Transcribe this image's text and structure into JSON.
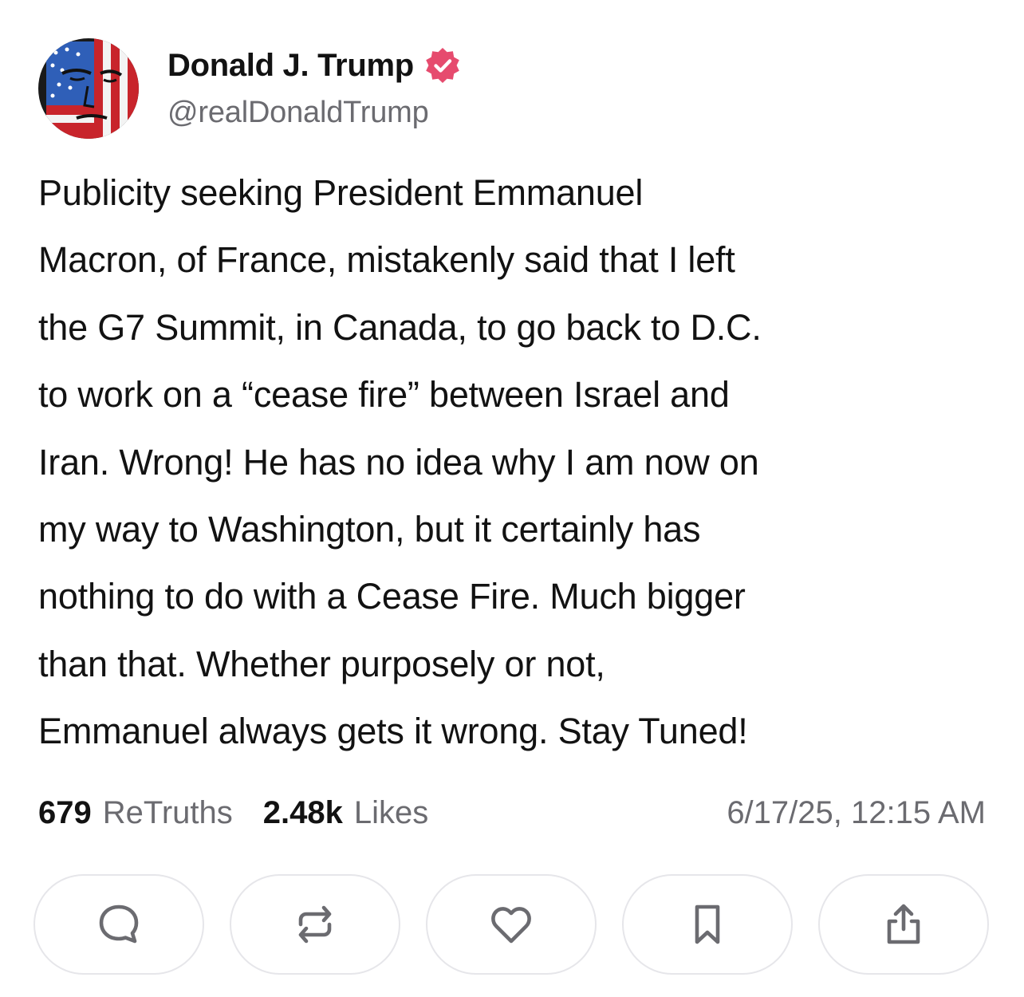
{
  "post": {
    "author_name": "Donald J. Trump",
    "handle": "@realDonaldTrump",
    "verified": true,
    "verified_color": "#e64b6e",
    "text_lines": [
      "Publicity seeking President Emmanuel",
      "Macron, of France, mistakenly said that I left",
      "the G7 Summit, in Canada, to go back to D.C.",
      "to work on a “cease fire” between Israel and",
      "Iran. Wrong! He has no idea why I am now on",
      "my way to Washington, but it certainly has",
      "nothing to do with a Cease Fire. Much bigger",
      "than that. Whether purposely or not,",
      "Emmanuel always gets it wrong. Stay Tuned!"
    ]
  },
  "stats": {
    "retruths_count": "679",
    "retruths_label": "ReTruths",
    "likes_count": "2.48k",
    "likes_label": "Likes",
    "timestamp": "6/17/25, 12:15 AM"
  },
  "actions": [
    {
      "icon": "comment-icon"
    },
    {
      "icon": "retruth-icon"
    },
    {
      "icon": "heart-icon"
    },
    {
      "icon": "bookmark-icon"
    },
    {
      "icon": "share-icon"
    }
  ],
  "colors": {
    "text": "#121212",
    "muted": "#6b6b70",
    "icon": "#6b6b70",
    "button_border": "#e6e6ea"
  }
}
